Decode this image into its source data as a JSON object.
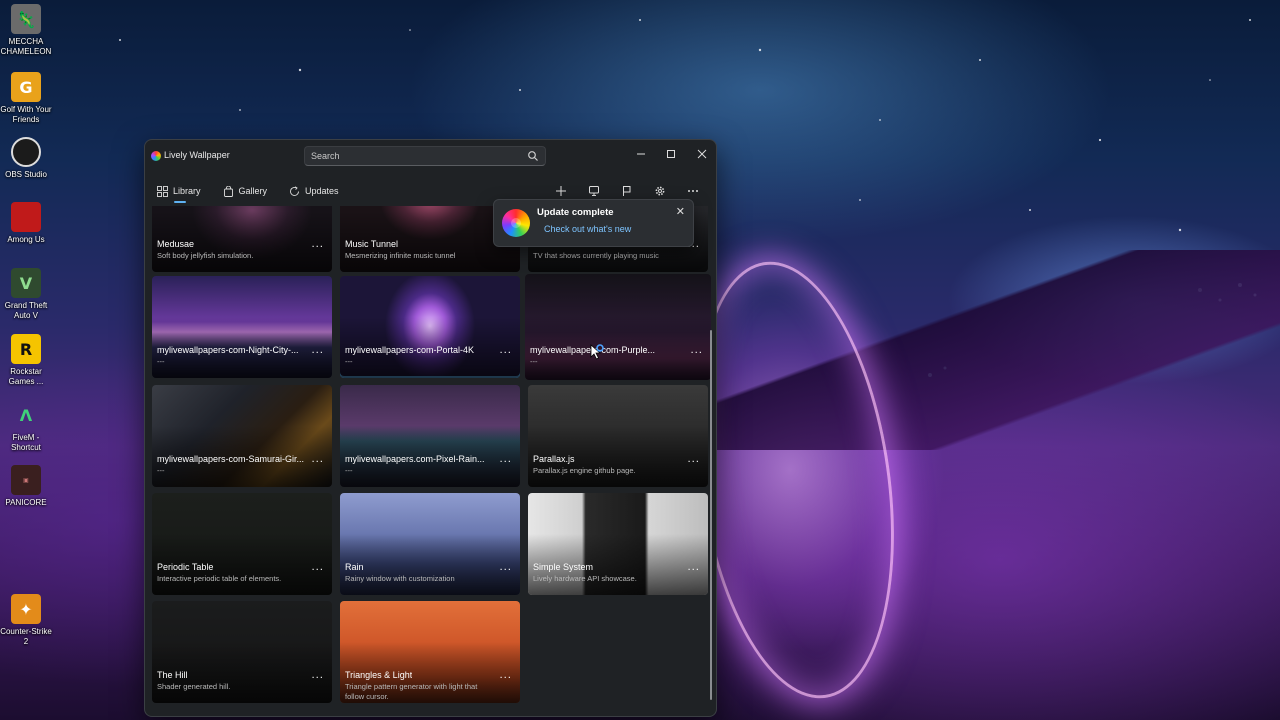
{
  "desktop": {
    "icons": [
      {
        "label": "MECCHA CHAMELEON",
        "icon": "meccha-chameleon-icon"
      },
      {
        "label": "Golf With Your Friends",
        "icon": "golf-with-your-friends-icon"
      },
      {
        "label": "OBS Studio",
        "icon": "obs-studio-icon"
      },
      {
        "label": "Among Us",
        "icon": "among-us-icon"
      },
      {
        "label": "Grand Theft Auto V",
        "icon": "gta-v-icon"
      },
      {
        "label": "Rockstar Games ...",
        "icon": "rockstar-games-icon"
      },
      {
        "label": "FiveM - Shortcut",
        "icon": "fivem-icon"
      },
      {
        "label": "PANICORE",
        "icon": "panicore-icon"
      },
      {
        "label": "Counter-Strike 2",
        "icon": "counter-strike-icon"
      }
    ]
  },
  "window": {
    "title": "Lively Wallpaper",
    "search_placeholder": "Search",
    "tabs": [
      {
        "label": "Library",
        "icon": "library-grid-icon",
        "active": true
      },
      {
        "label": "Gallery",
        "icon": "gallery-bag-icon",
        "active": false
      },
      {
        "label": "Updates",
        "icon": "refresh-icon",
        "active": false
      }
    ],
    "toolbar": [
      "add-icon",
      "display-icon",
      "flag-icon",
      "settings-icon",
      "more-icon"
    ]
  },
  "library": {
    "items": [
      {
        "title": "Medusae",
        "desc": "Soft body jellyfish simulation."
      },
      {
        "title": "Music Tunnel",
        "desc": "Mesmerizing infinite music tunnel"
      },
      {
        "title": "",
        "desc": "TV that shows currently playing music"
      },
      {
        "title": "mylivewallpapers-com-Night-City-...",
        "desc": "---"
      },
      {
        "title": "mylivewallpapers-com-Portal-4K",
        "desc": "---"
      },
      {
        "title": "mylivewallpapers-com-Purple...",
        "desc": "---"
      },
      {
        "title": "mylivewallpapers-com-Samurai-Gir...",
        "desc": "---"
      },
      {
        "title": "mylivewallpapers.com-Pixel-Rain...",
        "desc": "---"
      },
      {
        "title": "Parallax.js",
        "desc": "Parallax.js engine github page."
      },
      {
        "title": "Periodic Table",
        "desc": "Interactive periodic table of elements."
      },
      {
        "title": "Rain",
        "desc": "Rainy window with customization"
      },
      {
        "title": "Simple System",
        "desc": "Lively hardware API showcase."
      },
      {
        "title": "The Hill",
        "desc": "Shader generated hill."
      },
      {
        "title": "Triangles & Light",
        "desc": "Triangle pattern generator with light that follow cursor."
      }
    ],
    "more_label": "···"
  },
  "toast": {
    "title": "Update complete",
    "link": "Check out what's new",
    "close": "✕"
  }
}
